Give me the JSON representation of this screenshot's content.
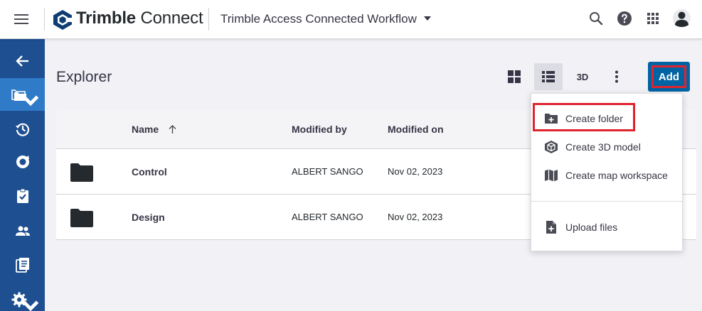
{
  "header": {
    "brand_bold": "Trimble",
    "brand_light": "Connect",
    "project_name": "Trimble Access Connected Workflow"
  },
  "icons": {
    "hamburger": "menu-icon",
    "search": "search-icon",
    "help": "help-icon",
    "apps": "apps-grid-icon",
    "user": "user-avatar-icon"
  },
  "sidebar": {
    "items": [
      {
        "icon": "arrow-left-icon",
        "active": false
      },
      {
        "icon": "folder-icon",
        "active": true,
        "has_caret": true
      },
      {
        "icon": "history-icon",
        "active": false
      },
      {
        "icon": "issues-icon",
        "active": false
      },
      {
        "icon": "clipboard-check-icon",
        "active": false
      },
      {
        "icon": "team-icon",
        "active": false
      },
      {
        "icon": "document-list-icon",
        "active": false
      },
      {
        "icon": "gear-icon",
        "active": false,
        "has_caret": true
      }
    ]
  },
  "main": {
    "title": "Explorer",
    "view_3d_label": "3D",
    "add_label": "Add"
  },
  "table": {
    "columns": {
      "name": "Name",
      "modified_by": "Modified by",
      "modified_on": "Modified on"
    },
    "rows": [
      {
        "name": "Control",
        "modified_by": "ALBERT SANGO",
        "modified_on": "Nov 02, 2023"
      },
      {
        "name": "Design",
        "modified_by": "ALBERT SANGO",
        "modified_on": "Nov 02, 2023"
      }
    ]
  },
  "add_menu": {
    "items": [
      {
        "label": "Create folder",
        "icon": "folder-plus-icon"
      },
      {
        "label": "Create 3D model",
        "icon": "sketchup-icon"
      },
      {
        "label": "Create map workspace",
        "icon": "map-icon"
      },
      {
        "label": "Upload files",
        "icon": "file-upload-icon"
      }
    ]
  },
  "colors": {
    "sidebar": "#1d4f91",
    "sidebar_active": "#2f7bc8",
    "add_button": "#0063a3",
    "highlight": "#e0242f",
    "folder": "#252a2e"
  }
}
